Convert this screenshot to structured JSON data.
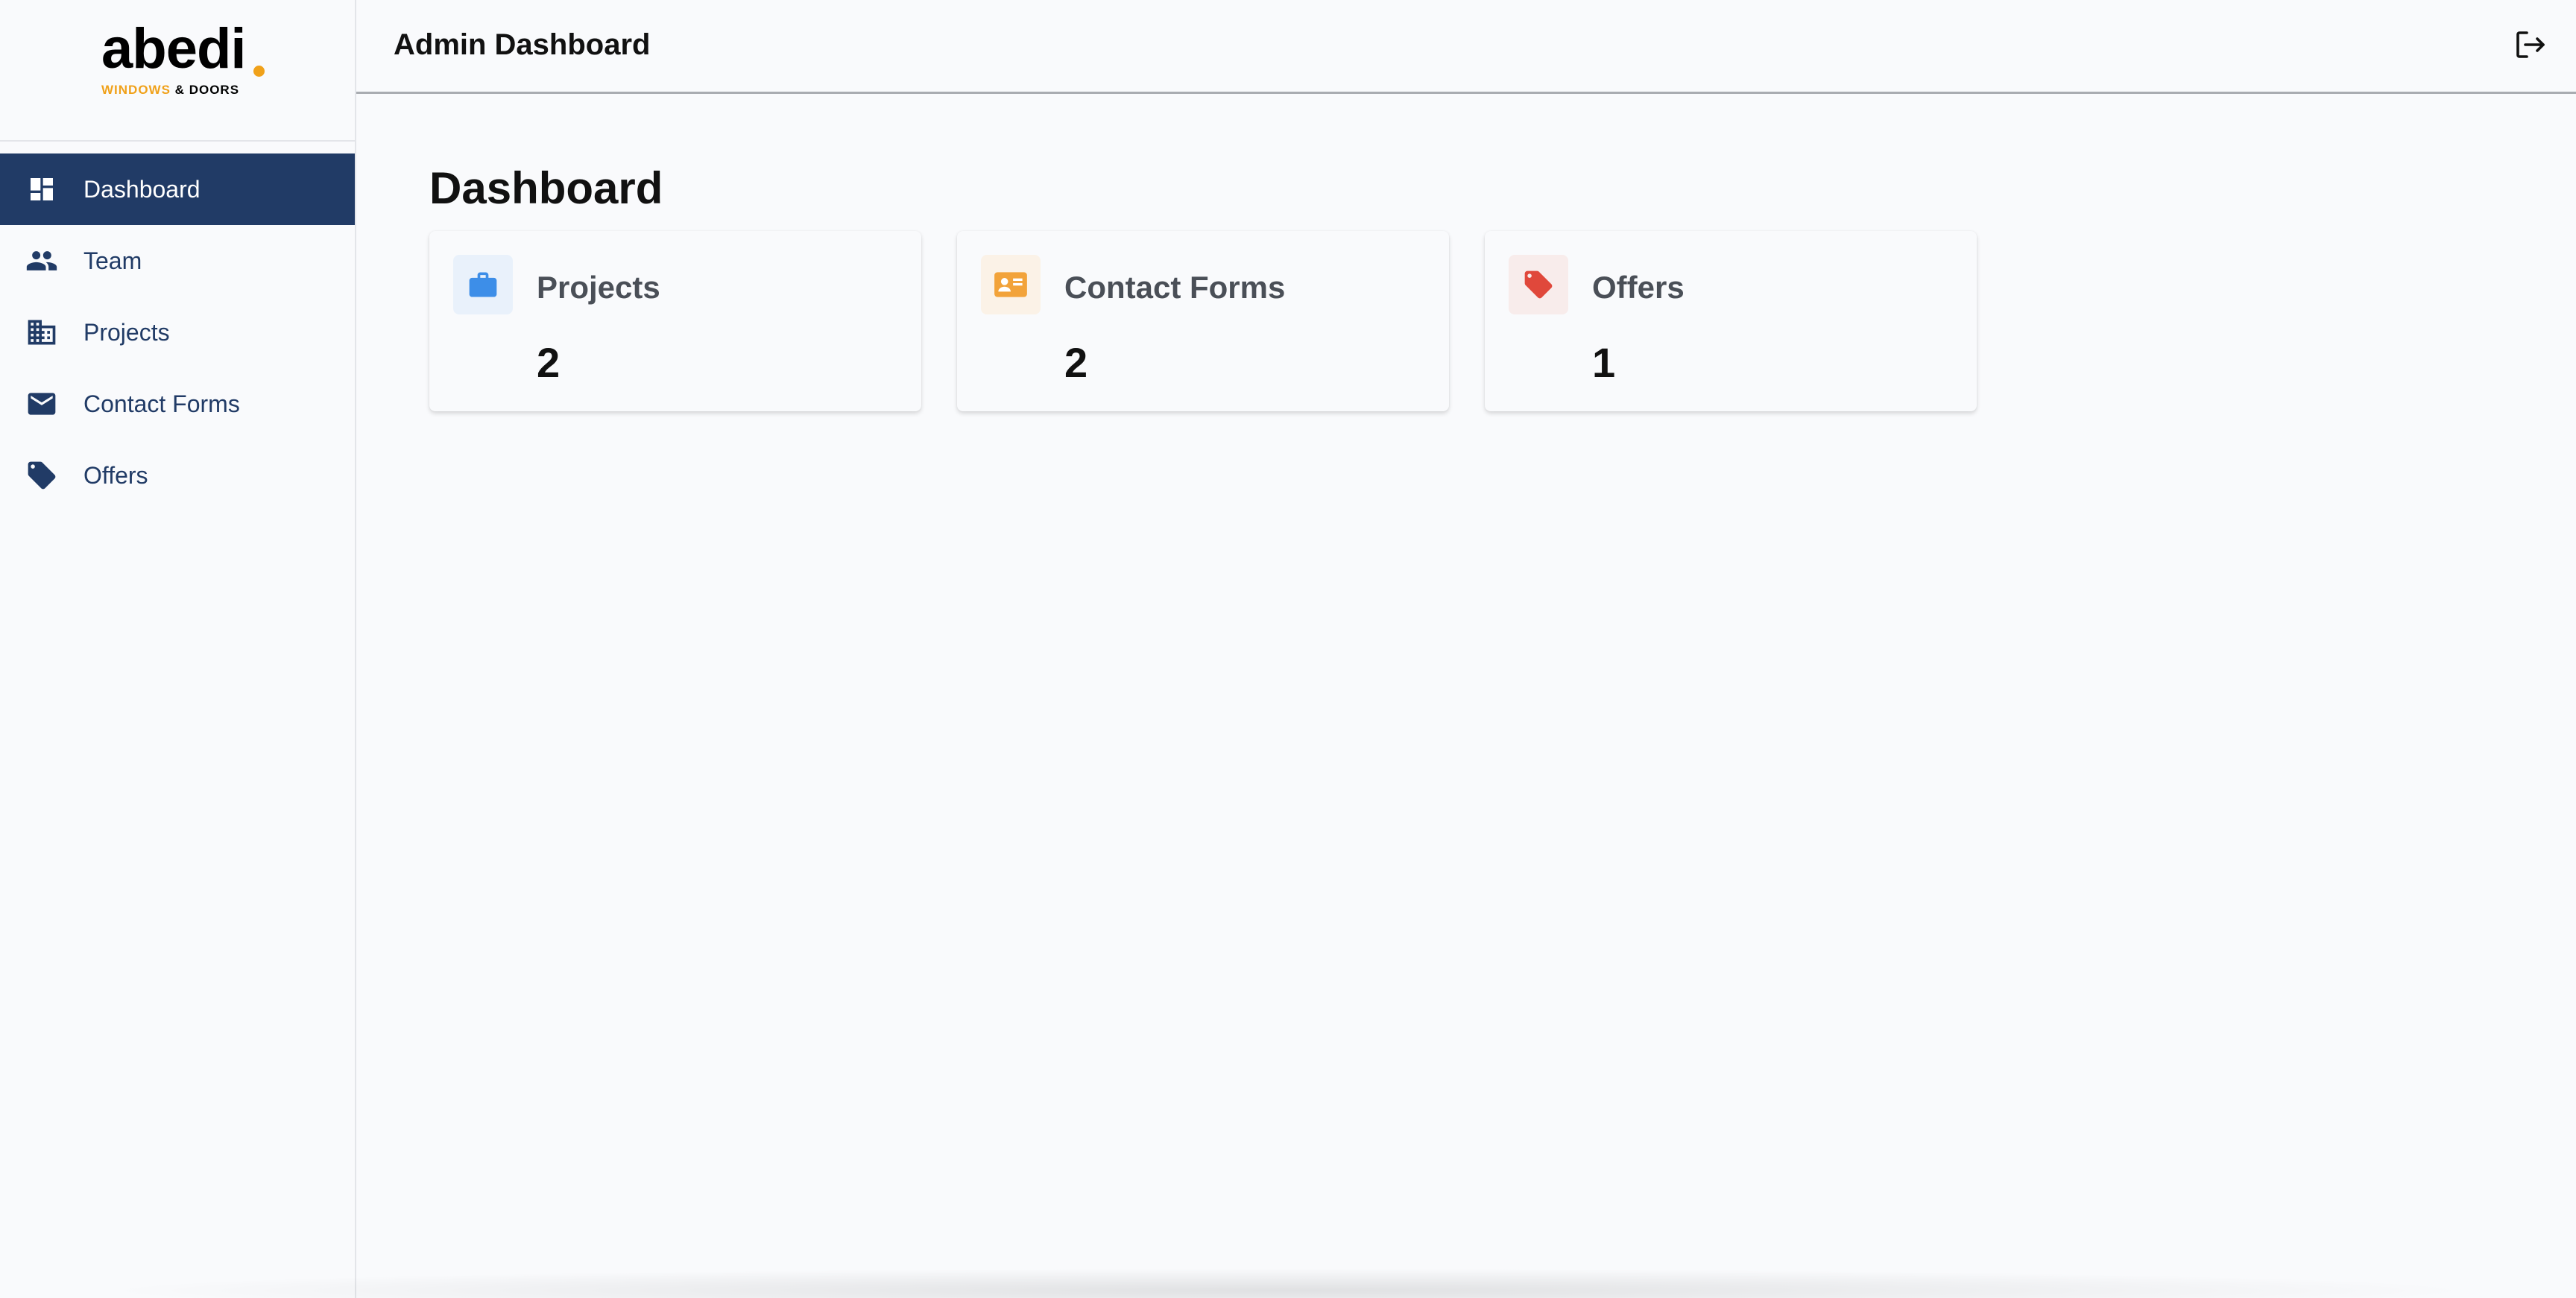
{
  "logo": {
    "word": "abedi",
    "sub_a": "WINDOWS",
    "sub_amp": "&",
    "sub_b": "DOORS",
    "accent": "#f0a11a"
  },
  "sidebar": {
    "items": [
      {
        "label": "Dashboard",
        "icon": "dashboard-icon",
        "active": true
      },
      {
        "label": "Team",
        "icon": "people-icon",
        "active": false
      },
      {
        "label": "Projects",
        "icon": "building-icon",
        "active": false
      },
      {
        "label": "Contact Forms",
        "icon": "mail-icon",
        "active": false
      },
      {
        "label": "Offers",
        "icon": "tag-icon",
        "active": false
      }
    ],
    "active_color": "#213b66"
  },
  "header": {
    "title": "Admin Dashboard",
    "logout_icon": "logout-icon"
  },
  "main": {
    "title": "Dashboard",
    "cards": [
      {
        "title": "Projects",
        "value": "2",
        "icon": "briefcase-icon",
        "color": "#3d8ee8",
        "bg": "#e9f1fb"
      },
      {
        "title": "Contact Forms",
        "value": "2",
        "icon": "contact-card-icon",
        "color": "#f2a33a",
        "bg": "#fbf2e7"
      },
      {
        "title": "Offers",
        "value": "1",
        "icon": "tag-icon",
        "color": "#e0483b",
        "bg": "#f8eceb"
      }
    ]
  }
}
